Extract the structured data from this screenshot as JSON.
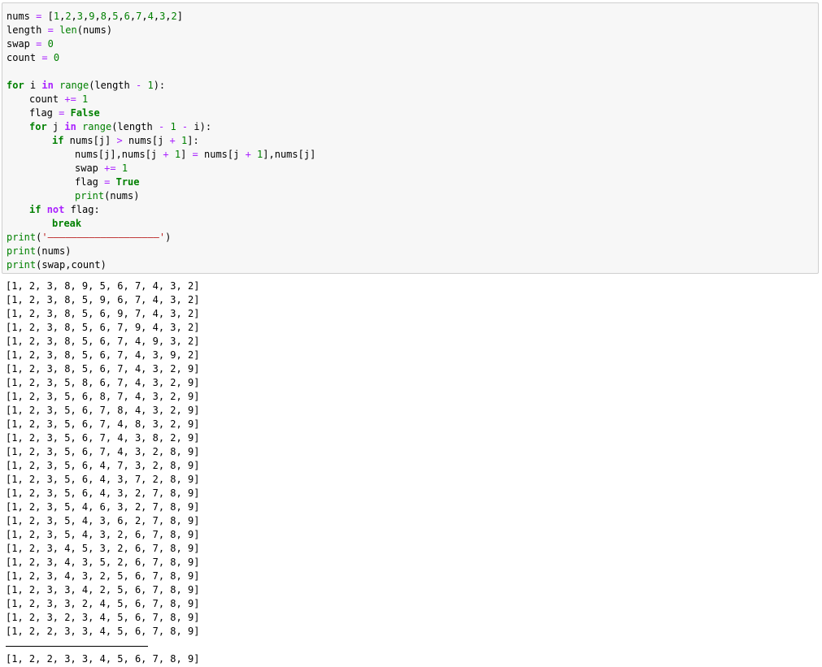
{
  "code_cell": {
    "lines": [
      {
        "indent": 0,
        "tokens": [
          {
            "t": "nums",
            "k": "name"
          },
          {
            "t": " ",
            "k": "pun"
          },
          {
            "t": "=",
            "k": "op"
          },
          {
            "t": " ",
            "k": "pun"
          },
          {
            "t": "[",
            "k": "pun"
          },
          {
            "t": "1",
            "k": "num"
          },
          {
            "t": ",",
            "k": "pun"
          },
          {
            "t": "2",
            "k": "num"
          },
          {
            "t": ",",
            "k": "pun"
          },
          {
            "t": "3",
            "k": "num"
          },
          {
            "t": ",",
            "k": "pun"
          },
          {
            "t": "9",
            "k": "num"
          },
          {
            "t": ",",
            "k": "pun"
          },
          {
            "t": "8",
            "k": "num"
          },
          {
            "t": ",",
            "k": "pun"
          },
          {
            "t": "5",
            "k": "num"
          },
          {
            "t": ",",
            "k": "pun"
          },
          {
            "t": "6",
            "k": "num"
          },
          {
            "t": ",",
            "k": "pun"
          },
          {
            "t": "7",
            "k": "num"
          },
          {
            "t": ",",
            "k": "pun"
          },
          {
            "t": "4",
            "k": "num"
          },
          {
            "t": ",",
            "k": "pun"
          },
          {
            "t": "3",
            "k": "num"
          },
          {
            "t": ",",
            "k": "pun"
          },
          {
            "t": "2",
            "k": "num"
          },
          {
            "t": "]",
            "k": "pun"
          }
        ]
      },
      {
        "indent": 0,
        "tokens": [
          {
            "t": "length",
            "k": "name"
          },
          {
            "t": " ",
            "k": "pun"
          },
          {
            "t": "=",
            "k": "op"
          },
          {
            "t": " ",
            "k": "pun"
          },
          {
            "t": "len",
            "k": "fn"
          },
          {
            "t": "(nums)",
            "k": "pun"
          }
        ]
      },
      {
        "indent": 0,
        "tokens": [
          {
            "t": "swap",
            "k": "name"
          },
          {
            "t": " ",
            "k": "pun"
          },
          {
            "t": "=",
            "k": "op"
          },
          {
            "t": " ",
            "k": "pun"
          },
          {
            "t": "0",
            "k": "num"
          }
        ]
      },
      {
        "indent": 0,
        "tokens": [
          {
            "t": "count",
            "k": "name"
          },
          {
            "t": " ",
            "k": "pun"
          },
          {
            "t": "=",
            "k": "op"
          },
          {
            "t": " ",
            "k": "pun"
          },
          {
            "t": "0",
            "k": "num"
          }
        ]
      },
      {
        "indent": 0,
        "tokens": []
      },
      {
        "indent": 0,
        "tokens": [
          {
            "t": "for",
            "k": "kw"
          },
          {
            "t": " i ",
            "k": "name"
          },
          {
            "t": "in",
            "k": "kwop"
          },
          {
            "t": " ",
            "k": "pun"
          },
          {
            "t": "range",
            "k": "fn"
          },
          {
            "t": "(length ",
            "k": "pun"
          },
          {
            "t": "-",
            "k": "op"
          },
          {
            "t": " ",
            "k": "pun"
          },
          {
            "t": "1",
            "k": "num"
          },
          {
            "t": "):",
            "k": "pun"
          }
        ]
      },
      {
        "indent": 1,
        "tokens": [
          {
            "t": "count",
            "k": "name"
          },
          {
            "t": " ",
            "k": "pun"
          },
          {
            "t": "+=",
            "k": "op"
          },
          {
            "t": " ",
            "k": "pun"
          },
          {
            "t": "1",
            "k": "num"
          }
        ]
      },
      {
        "indent": 1,
        "tokens": [
          {
            "t": "flag",
            "k": "name"
          },
          {
            "t": " ",
            "k": "pun"
          },
          {
            "t": "=",
            "k": "op"
          },
          {
            "t": " ",
            "k": "pun"
          },
          {
            "t": "False",
            "k": "kw"
          }
        ]
      },
      {
        "indent": 1,
        "tokens": [
          {
            "t": "for",
            "k": "kw"
          },
          {
            "t": " j ",
            "k": "name"
          },
          {
            "t": "in",
            "k": "kwop"
          },
          {
            "t": " ",
            "k": "pun"
          },
          {
            "t": "range",
            "k": "fn"
          },
          {
            "t": "(length ",
            "k": "pun"
          },
          {
            "t": "-",
            "k": "op"
          },
          {
            "t": " ",
            "k": "pun"
          },
          {
            "t": "1",
            "k": "num"
          },
          {
            "t": " ",
            "k": "pun"
          },
          {
            "t": "-",
            "k": "op"
          },
          {
            "t": " i):",
            "k": "pun"
          }
        ]
      },
      {
        "indent": 2,
        "tokens": [
          {
            "t": "if",
            "k": "kw"
          },
          {
            "t": " nums[j] ",
            "k": "name"
          },
          {
            "t": ">",
            "k": "op"
          },
          {
            "t": " nums[j ",
            "k": "name"
          },
          {
            "t": "+",
            "k": "op"
          },
          {
            "t": " ",
            "k": "pun"
          },
          {
            "t": "1",
            "k": "num"
          },
          {
            "t": "]:",
            "k": "pun"
          }
        ]
      },
      {
        "indent": 3,
        "tokens": [
          {
            "t": "nums[j],nums[j ",
            "k": "name"
          },
          {
            "t": "+",
            "k": "op"
          },
          {
            "t": " ",
            "k": "pun"
          },
          {
            "t": "1",
            "k": "num"
          },
          {
            "t": "] ",
            "k": "pun"
          },
          {
            "t": "=",
            "k": "op"
          },
          {
            "t": " nums[j ",
            "k": "name"
          },
          {
            "t": "+",
            "k": "op"
          },
          {
            "t": " ",
            "k": "pun"
          },
          {
            "t": "1",
            "k": "num"
          },
          {
            "t": "],nums[j]",
            "k": "pun"
          }
        ]
      },
      {
        "indent": 3,
        "tokens": [
          {
            "t": "swap",
            "k": "name"
          },
          {
            "t": " ",
            "k": "pun"
          },
          {
            "t": "+=",
            "k": "op"
          },
          {
            "t": " ",
            "k": "pun"
          },
          {
            "t": "1",
            "k": "num"
          }
        ]
      },
      {
        "indent": 3,
        "tokens": [
          {
            "t": "flag",
            "k": "name"
          },
          {
            "t": " ",
            "k": "pun"
          },
          {
            "t": "=",
            "k": "op"
          },
          {
            "t": " ",
            "k": "pun"
          },
          {
            "t": "True",
            "k": "kw"
          }
        ]
      },
      {
        "indent": 3,
        "tokens": [
          {
            "t": "print",
            "k": "fn"
          },
          {
            "t": "(nums)",
            "k": "pun"
          }
        ]
      },
      {
        "indent": 1,
        "tokens": [
          {
            "t": "if",
            "k": "kw"
          },
          {
            "t": " ",
            "k": "pun"
          },
          {
            "t": "not",
            "k": "kwop"
          },
          {
            "t": " flag:",
            "k": "name"
          }
        ]
      },
      {
        "indent": 2,
        "tokens": [
          {
            "t": "break",
            "k": "kw"
          }
        ]
      },
      {
        "indent": 0,
        "tokens": [
          {
            "t": "print",
            "k": "fn"
          },
          {
            "t": "(",
            "k": "pun"
          },
          {
            "t": "'———————————————————'",
            "k": "str"
          },
          {
            "t": ")",
            "k": "pun"
          }
        ]
      },
      {
        "indent": 0,
        "tokens": [
          {
            "t": "print",
            "k": "fn"
          },
          {
            "t": "(nums)",
            "k": "pun"
          }
        ]
      },
      {
        "indent": 0,
        "tokens": [
          {
            "t": "print",
            "k": "fn"
          },
          {
            "t": "(swap,count)",
            "k": "pun"
          }
        ]
      }
    ]
  },
  "output": {
    "lines": [
      "[1, 2, 3, 8, 9, 5, 6, 7, 4, 3, 2]",
      "[1, 2, 3, 8, 5, 9, 6, 7, 4, 3, 2]",
      "[1, 2, 3, 8, 5, 6, 9, 7, 4, 3, 2]",
      "[1, 2, 3, 8, 5, 6, 7, 9, 4, 3, 2]",
      "[1, 2, 3, 8, 5, 6, 7, 4, 9, 3, 2]",
      "[1, 2, 3, 8, 5, 6, 7, 4, 3, 9, 2]",
      "[1, 2, 3, 8, 5, 6, 7, 4, 3, 2, 9]",
      "[1, 2, 3, 5, 8, 6, 7, 4, 3, 2, 9]",
      "[1, 2, 3, 5, 6, 8, 7, 4, 3, 2, 9]",
      "[1, 2, 3, 5, 6, 7, 8, 4, 3, 2, 9]",
      "[1, 2, 3, 5, 6, 7, 4, 8, 3, 2, 9]",
      "[1, 2, 3, 5, 6, 7, 4, 3, 8, 2, 9]",
      "[1, 2, 3, 5, 6, 7, 4, 3, 2, 8, 9]",
      "[1, 2, 3, 5, 6, 4, 7, 3, 2, 8, 9]",
      "[1, 2, 3, 5, 6, 4, 3, 7, 2, 8, 9]",
      "[1, 2, 3, 5, 6, 4, 3, 2, 7, 8, 9]",
      "[1, 2, 3, 5, 4, 6, 3, 2, 7, 8, 9]",
      "[1, 2, 3, 5, 4, 3, 6, 2, 7, 8, 9]",
      "[1, 2, 3, 5, 4, 3, 2, 6, 7, 8, 9]",
      "[1, 2, 3, 4, 5, 3, 2, 6, 7, 8, 9]",
      "[1, 2, 3, 4, 3, 5, 2, 6, 7, 8, 9]",
      "[1, 2, 3, 4, 3, 2, 5, 6, 7, 8, 9]",
      "[1, 2, 3, 3, 4, 2, 5, 6, 7, 8, 9]",
      "[1, 2, 3, 3, 2, 4, 5, 6, 7, 8, 9]",
      "[1, 2, 3, 2, 3, 4, 5, 6, 7, 8, 9]",
      "[1, 2, 2, 3, 3, 4, 5, 6, 7, 8, 9]"
    ],
    "final_line": "[1, 2, 2, 3, 3, 4, 5, 6, 7, 8, 9]"
  }
}
